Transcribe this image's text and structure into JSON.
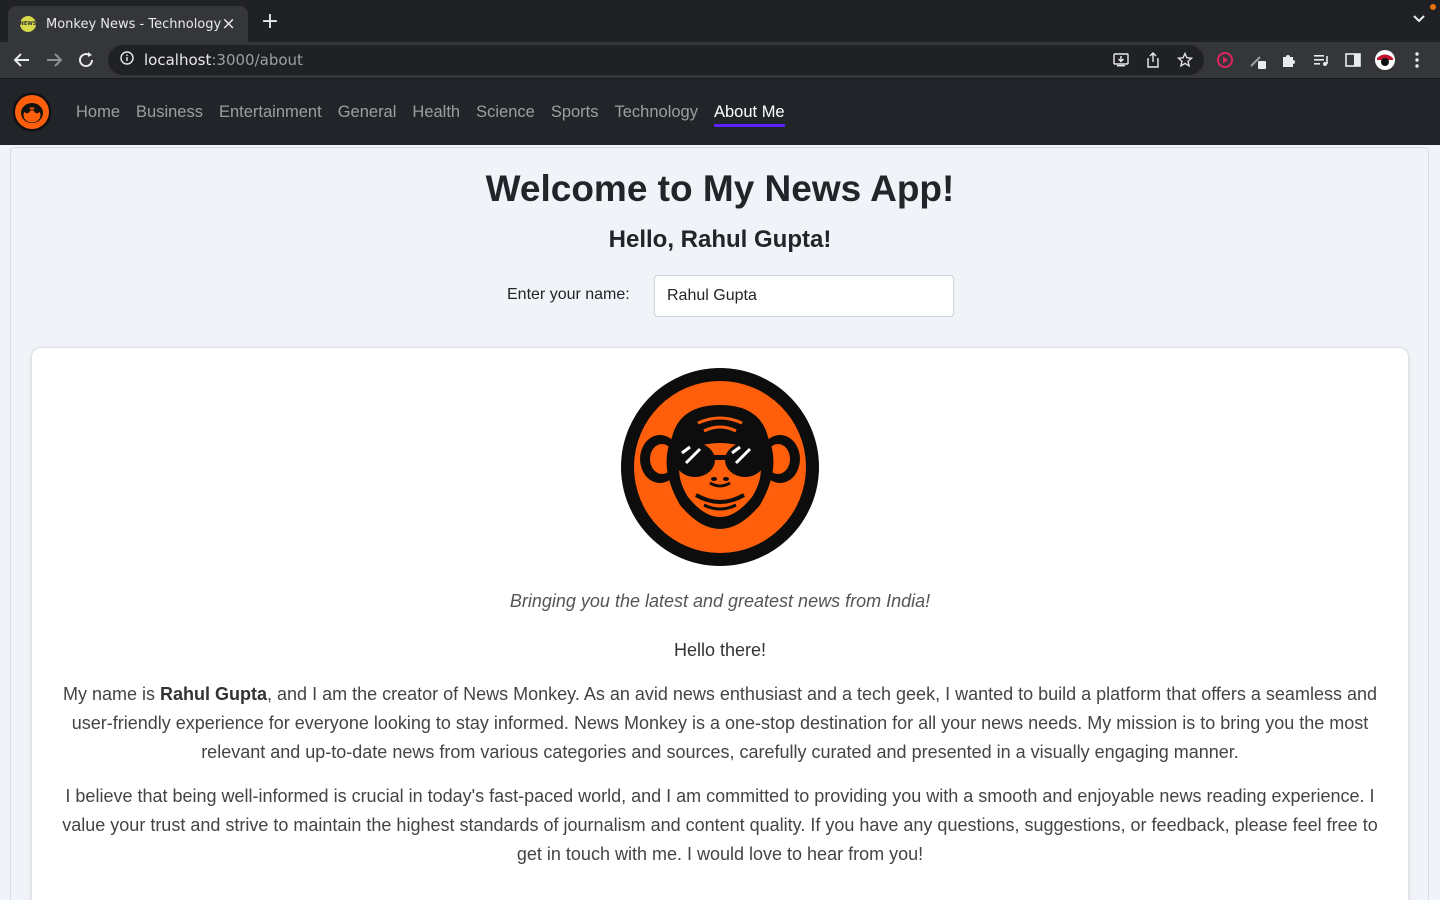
{
  "browser": {
    "tab_title": "Monkey News - Technology",
    "favicon_text": "NEWS",
    "url_host": "localhost",
    "url_path": ":3000/about"
  },
  "navbar": {
    "links": [
      {
        "label": "Home",
        "active": false
      },
      {
        "label": "Business",
        "active": false
      },
      {
        "label": "Entertainment",
        "active": false
      },
      {
        "label": "General",
        "active": false
      },
      {
        "label": "Health",
        "active": false
      },
      {
        "label": "Science",
        "active": false
      },
      {
        "label": "Sports",
        "active": false
      },
      {
        "label": "Technology",
        "active": false
      },
      {
        "label": "About Me",
        "active": true
      }
    ],
    "active_underline_color": "#5b21ff"
  },
  "page": {
    "welcome_title": "Welcome to My News App!",
    "hello_prefix": "Hello, ",
    "hello_name": "Rahul Gupta",
    "hello_suffix": "!",
    "name_label": "Enter your name:",
    "name_value": "Rahul Gupta"
  },
  "about": {
    "tagline": "Bringing you the latest and greatest news from India!",
    "greeting": "Hello there!",
    "para1_prefix": "My name is ",
    "para1_name": "Rahul Gupta",
    "para1_rest": ", and I am the creator of News Monkey. As an avid news enthusiast and a tech geek, I wanted to build a platform that offers a seamless and user-friendly experience for everyone looking to stay informed. News Monkey is a one-stop destination for all your news needs. My mission is to bring you the most relevant and up-to-date news from various categories and sources, carefully curated and presented in a visually engaging manner.",
    "para2": "I believe that being well-informed is crucial in today's fast-paced world, and I am committed to providing you with a smooth and enjoyable news reading experience. I value your trust and strive to maintain the highest standards of journalism and content quality. If you have any questions, suggestions, or feedback, please feel free to get in touch with me. I would love to hear from you!"
  },
  "colors": {
    "logo_orange": "#ff5f0a",
    "navbar_bg": "#212529"
  }
}
